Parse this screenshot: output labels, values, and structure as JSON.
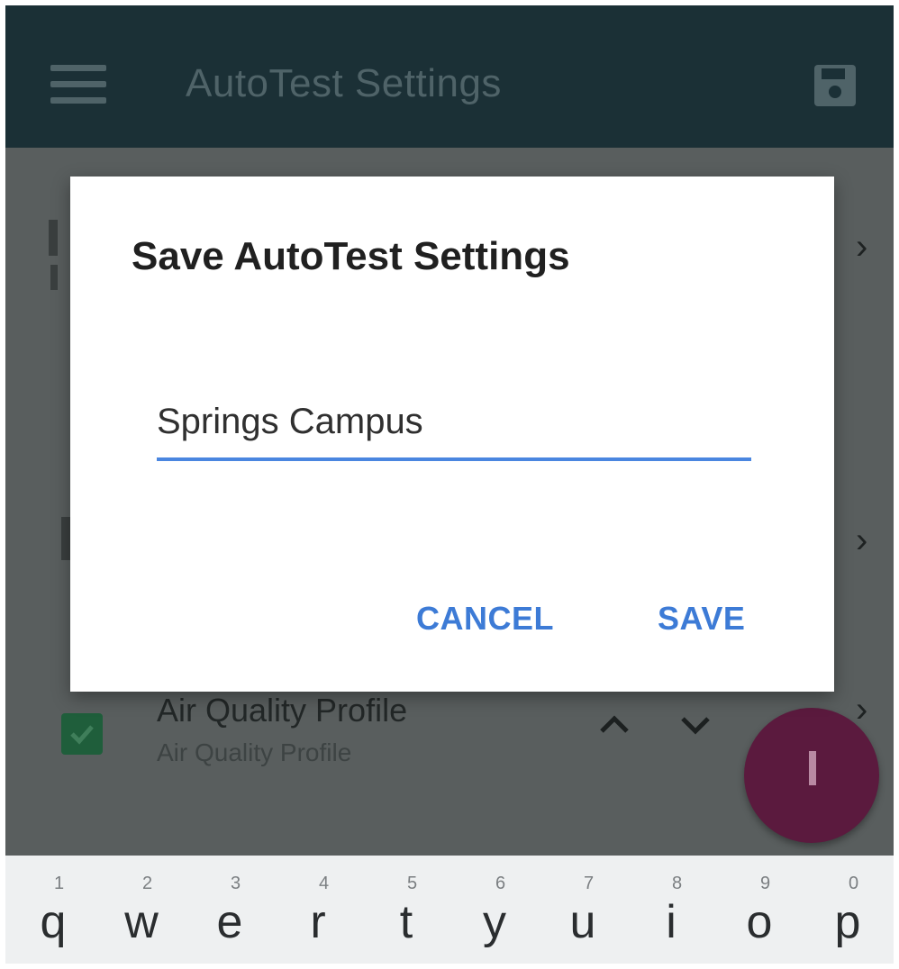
{
  "app_bar": {
    "title": "AutoTest Settings",
    "menu_icon": "hamburger-menu-icon",
    "save_icon": "floppy-disk-save-icon"
  },
  "background_list": {
    "profile_item": {
      "title": "Air Quality Profile",
      "subtitle": "Air Quality Profile"
    },
    "checkbox_color": "#1f5e3b",
    "fab_color": "#5b1a3e"
  },
  "dialog": {
    "title": "Save AutoTest Settings",
    "input_value": "Springs Campus",
    "cancel_label": "CANCEL",
    "save_label": "SAVE",
    "accent_color": "#3d7bd6"
  },
  "keyboard": {
    "keys": [
      {
        "letter": "q",
        "number": "1"
      },
      {
        "letter": "w",
        "number": "2"
      },
      {
        "letter": "e",
        "number": "3"
      },
      {
        "letter": "r",
        "number": "4"
      },
      {
        "letter": "t",
        "number": "5"
      },
      {
        "letter": "y",
        "number": "6"
      },
      {
        "letter": "u",
        "number": "7"
      },
      {
        "letter": "i",
        "number": "8"
      },
      {
        "letter": "o",
        "number": "9"
      },
      {
        "letter": "p",
        "number": "0"
      }
    ]
  }
}
